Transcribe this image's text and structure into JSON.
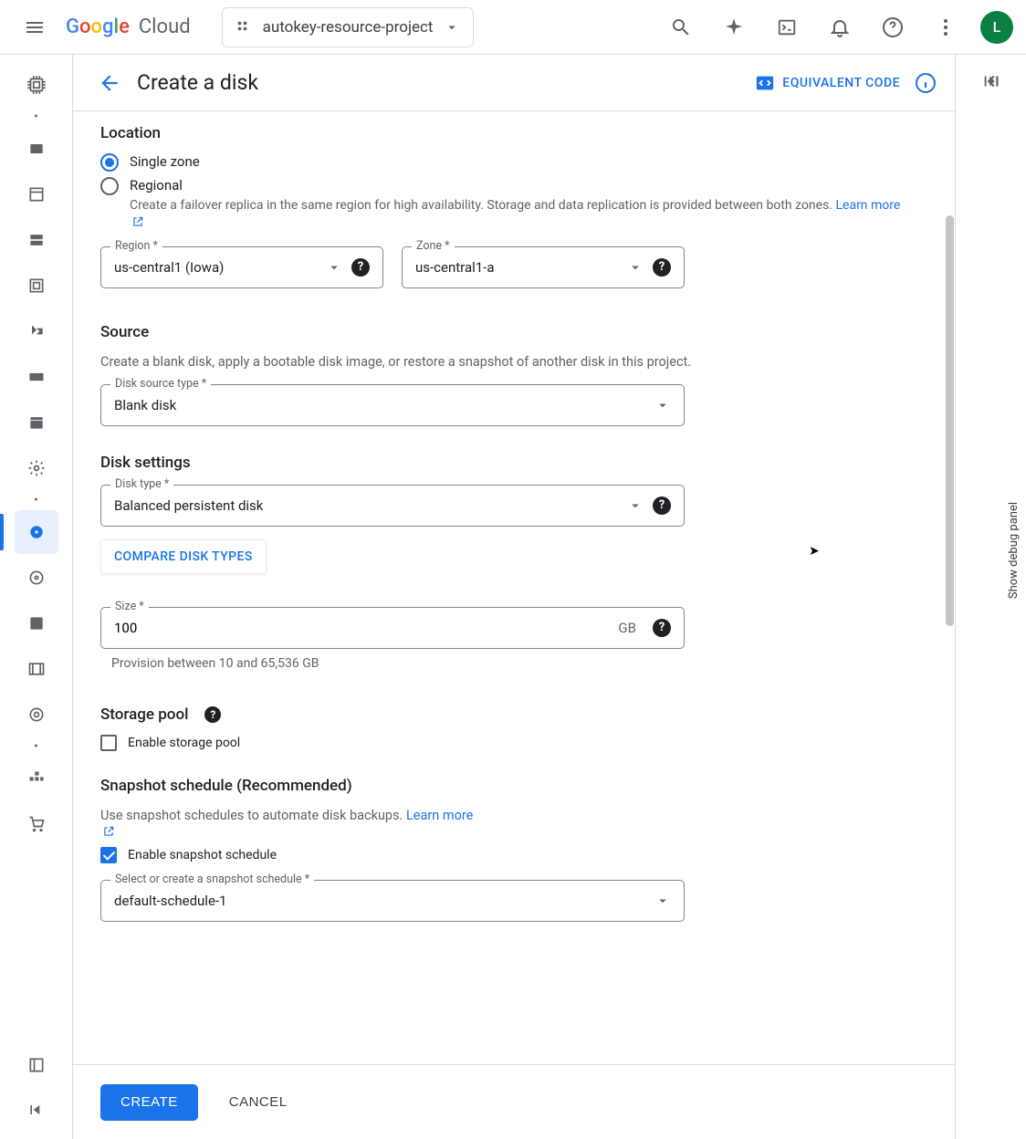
{
  "header": {
    "logo_text": "Google Cloud",
    "project_name": "autokey-resource-project",
    "avatar_letter": "L"
  },
  "page": {
    "title": "Create a disk",
    "equiv_code": "EQUIVALENT CODE"
  },
  "location": {
    "heading": "Location",
    "single_zone": "Single zone",
    "regional": "Regional",
    "regional_desc": "Create a failover replica in the same region for high availability. Storage and data replication is provided between both zones.",
    "learn_more": "Learn more",
    "region_label": "Region *",
    "region_value": "us-central1 (Iowa)",
    "zone_label": "Zone *",
    "zone_value": "us-central1-a"
  },
  "source": {
    "heading": "Source",
    "desc": "Create a blank disk, apply a bootable disk image, or restore a snapshot of another disk in this project.",
    "field_label": "Disk source type *",
    "field_value": "Blank disk"
  },
  "disk_settings": {
    "heading": "Disk settings",
    "type_label": "Disk type *",
    "type_value": "Balanced persistent disk",
    "compare": "COMPARE DISK TYPES",
    "size_label": "Size *",
    "size_value": "100",
    "size_unit": "GB",
    "size_helper": "Provision between 10 and 65,536 GB"
  },
  "storage_pool": {
    "heading": "Storage pool",
    "enable": "Enable storage pool"
  },
  "snapshot": {
    "heading": "Snapshot schedule (Recommended)",
    "desc": "Use snapshot schedules to automate disk backups.",
    "learn_more": "Learn more",
    "enable": "Enable snapshot schedule",
    "select_label": "Select or create a snapshot schedule *",
    "select_value": "default-schedule-1"
  },
  "footer": {
    "create": "CREATE",
    "cancel": "CANCEL"
  },
  "right": {
    "debug": "Show debug panel"
  }
}
